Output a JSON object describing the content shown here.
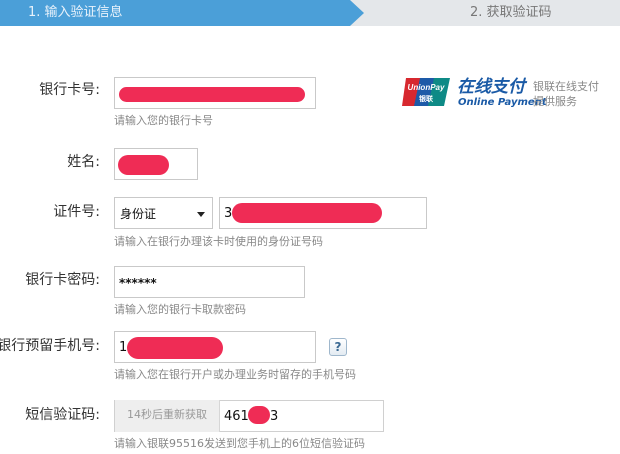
{
  "steps": {
    "step1": "1. 输入验证信息",
    "step2": "2. 获取验证码"
  },
  "badge": {
    "logo_top": "UnionPay",
    "logo_bottom": "银联",
    "title_cn": "在线支付",
    "title_en": "Online Payment",
    "desc_line1": "银联在线支付",
    "desc_line2": "提供服务"
  },
  "form": {
    "card_number": {
      "label": "银行卡号:",
      "hint": "请输入您的银行卡号"
    },
    "name": {
      "label": "姓名:"
    },
    "id_number": {
      "label": "证件号:",
      "id_type": "身份证",
      "value_prefix": "3",
      "hint": "请输入在银行办理该卡时使用的身份证号码"
    },
    "card_password": {
      "label": "银行卡密码:",
      "value": "******",
      "hint": "请输入您的银行卡取款密码"
    },
    "phone": {
      "label": "银行预留手机号:",
      "value_prefix": "1",
      "help": "?",
      "hint": "请输入您在银行开户或办理业务时留存的手机号码"
    },
    "sms_code": {
      "label": "短信验证码:",
      "resend_button": "14秒后重新获取",
      "value_prefix": "461",
      "value_suffix": "3",
      "hint": "请输入银联95516发送到您手机上的6位短信验证码"
    }
  },
  "colors": {
    "progress_active": "#4b9fd8",
    "progress_inactive": "#e4e7ea",
    "redaction": "#ef2c55",
    "brand_blue": "#1a5aa6"
  }
}
